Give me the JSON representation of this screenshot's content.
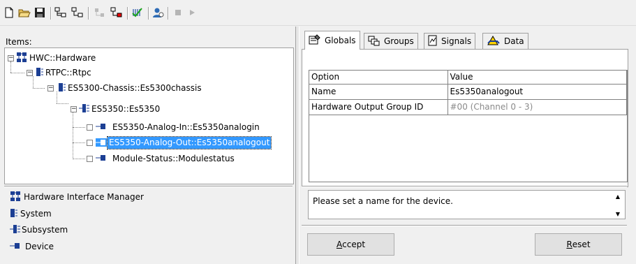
{
  "toolbar": {
    "buttons": [
      "new-icon",
      "open-icon",
      "save-icon",
      "add-group-icon",
      "add-sibling-icon",
      "disabled-icon",
      "add-child-icon",
      "check-icon",
      "user-icon",
      "stop-icon",
      "play-icon"
    ]
  },
  "left": {
    "items_label": "Items:",
    "tree": [
      {
        "label": "HWC::Hardware"
      },
      {
        "label": "RTPC::Rtpc"
      },
      {
        "label": "ES5300-Chassis::Es5300chassis"
      },
      {
        "label": "ES5350::Es5350"
      },
      {
        "label": "ES5350-Analog-In::Es5350analogin"
      },
      {
        "label": "ES5350-Analog-Out::Es5350analogout"
      },
      {
        "label": "Module-Status::Modulestatus"
      }
    ],
    "legend": [
      {
        "label": "Hardware Interface Manager"
      },
      {
        "label": "System"
      },
      {
        "label": "Subsystem"
      },
      {
        "label": "Device"
      }
    ]
  },
  "right": {
    "tabs": [
      {
        "label": "Globals"
      },
      {
        "label": "Groups"
      },
      {
        "label": "Signals"
      },
      {
        "label": "Data"
      }
    ],
    "grid": {
      "headers": [
        "Option",
        "Value"
      ],
      "rows": [
        [
          "Name",
          "Es5350analogout"
        ],
        [
          "Hardware Output Group ID",
          "#00 (Channel 0 - 3)"
        ]
      ]
    },
    "message": "Please set a name for the device.",
    "accept_prefix": "A",
    "accept_rest": "ccept",
    "reset_prefix": "R",
    "reset_rest": "eset"
  },
  "colors": {
    "selection": "#3399ff",
    "device_icon": "#1c3f94"
  }
}
